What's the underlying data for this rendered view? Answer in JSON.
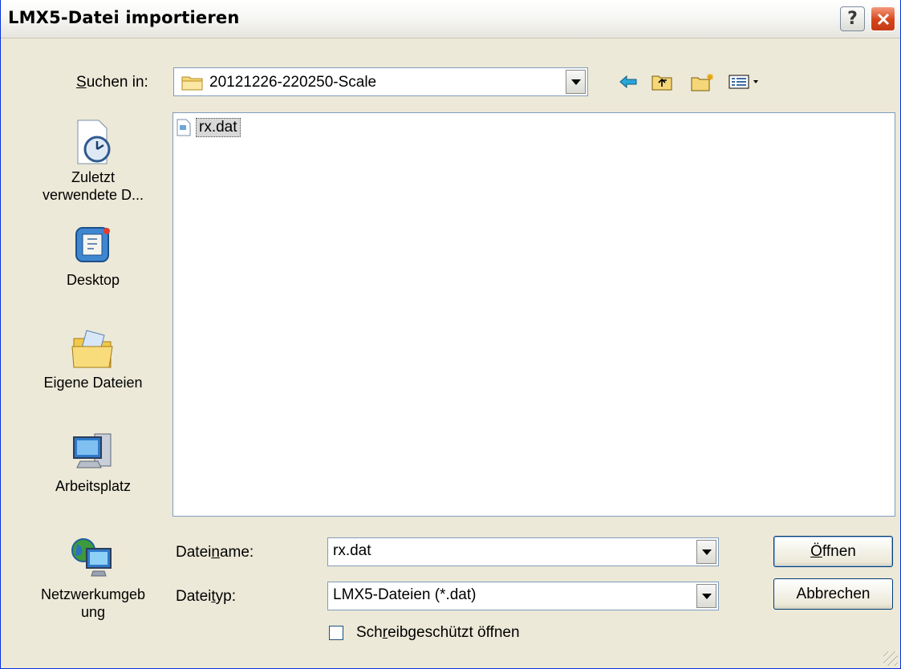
{
  "window": {
    "title": "LMX5-Datei importieren",
    "help_label": "?"
  },
  "lookin": {
    "label_pre": "S",
    "label_rest": "uchen in:",
    "value": "20121226-220250-Scale"
  },
  "places": [
    {
      "label_line1": "Zuletzt",
      "label_line2": "verwendete D...",
      "icon": "recent-documents-icon"
    },
    {
      "label_line1": "Desktop",
      "label_line2": "",
      "icon": "desktop-icon"
    },
    {
      "label_line1": "Eigene Dateien",
      "label_line2": "",
      "icon": "my-documents-icon"
    },
    {
      "label_line1": "Arbeitsplatz",
      "label_line2": "",
      "icon": "my-computer-icon"
    },
    {
      "label_line1": "Netzwerkumgeb",
      "label_line2": "ung",
      "icon": "network-icon"
    }
  ],
  "files": [
    {
      "name": "rx.dat",
      "selected": true
    }
  ],
  "filename": {
    "label_a": "Datei",
    "label_u": "n",
    "label_b": "ame:",
    "value": "rx.dat"
  },
  "filetype": {
    "label_a": "Datei",
    "label_u": "t",
    "label_b": "yp:",
    "value": "LMX5-Dateien  (*.dat)"
  },
  "readonly": {
    "label_a": "Sch",
    "label_u": "r",
    "label_b": "eibgeschützt öffnen",
    "checked": false
  },
  "buttons": {
    "open_pre": "Ö",
    "open_rest": "ffnen",
    "cancel": "Abbrechen"
  },
  "colors": {
    "dialog_bg": "#ece9d8",
    "field_border": "#7f9db9",
    "close_red": "#d6441b"
  }
}
